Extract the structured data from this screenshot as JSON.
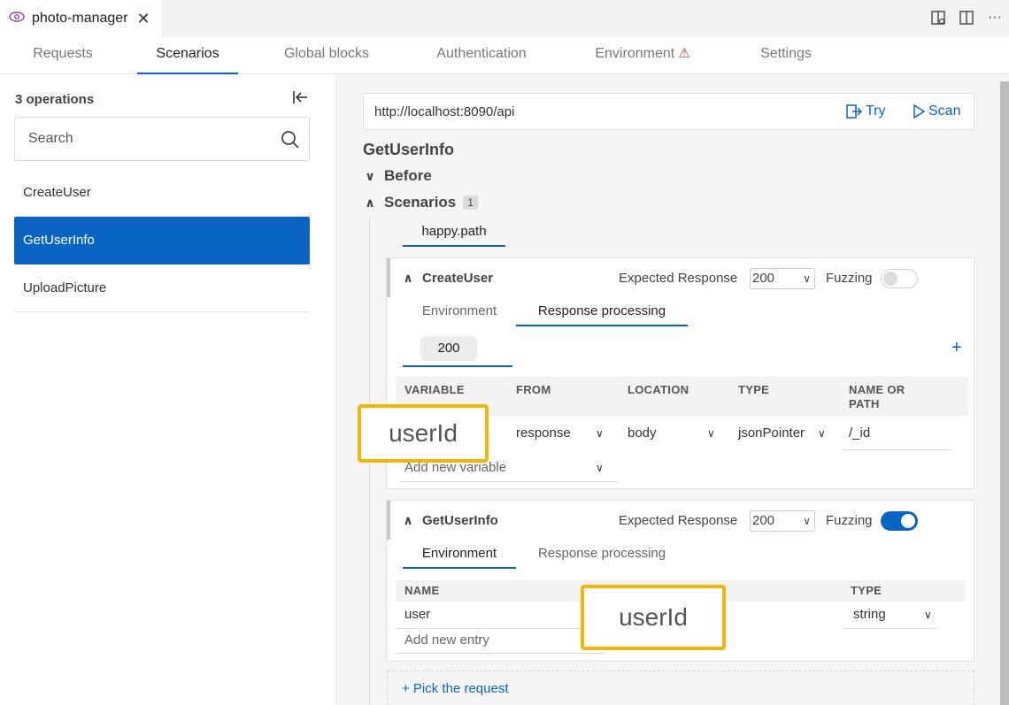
{
  "window": {
    "tab_title": "photo-manager",
    "close_glyph": "✕",
    "actions": [
      "split-layout-icon",
      "split-editor-icon",
      "more-icon"
    ]
  },
  "nav": {
    "tabs": [
      {
        "label": "Requests",
        "active": false
      },
      {
        "label": "Scenarios",
        "active": true
      },
      {
        "label": "Global blocks",
        "active": false
      },
      {
        "label": "Authentication",
        "active": false
      },
      {
        "label": "Environment",
        "active": false,
        "warning": true
      },
      {
        "label": "Settings",
        "active": false
      }
    ]
  },
  "sidebar": {
    "count_label": "3 operations",
    "search_placeholder": "Search",
    "items": [
      {
        "label": "CreateUser",
        "active": false
      },
      {
        "label": "GetUserInfo",
        "active": true
      },
      {
        "label": "UploadPicture",
        "active": false
      }
    ]
  },
  "main": {
    "url": "http://localhost:8090/api",
    "try_label": "Try",
    "scan_label": "Scan",
    "operation_title": "GetUserInfo",
    "before_label": "Before",
    "scenarios_label": "Scenarios",
    "scenarios_count": "1",
    "scenario_tab": "happy.path",
    "steps": [
      {
        "title": "CreateUser",
        "expected_label": "Expected Response",
        "expected_value": "200",
        "fuzzing_label": "Fuzzing",
        "fuzzing_on": false,
        "tabs": [
          "Environment",
          "Response processing"
        ],
        "active_tab": "Response processing",
        "code_chip": "200",
        "columns": [
          "VARIABLE NAME",
          "FROM",
          "LOCATION",
          "TYPE",
          "NAME OR PATH"
        ],
        "row": {
          "variable": "userId",
          "from": "response",
          "location": "body",
          "type": "jsonPointer",
          "path": "/_id"
        },
        "add_placeholder": "Add new variable"
      },
      {
        "title": "GetUserInfo",
        "expected_label": "Expected Response",
        "expected_value": "200",
        "fuzzing_label": "Fuzzing",
        "fuzzing_on": true,
        "tabs": [
          "Environment",
          "Response processing"
        ],
        "active_tab": "Environment",
        "columns": [
          "NAME",
          "",
          "TYPE"
        ],
        "row": {
          "name": "user",
          "value": "userId",
          "type": "string"
        },
        "add_placeholder": "Add new entry"
      }
    ],
    "pick_request_label": "+ Pick the request"
  },
  "colors": {
    "accent": "#0a64c4",
    "highlight": "#f2b705",
    "warning": "#c0392b"
  }
}
